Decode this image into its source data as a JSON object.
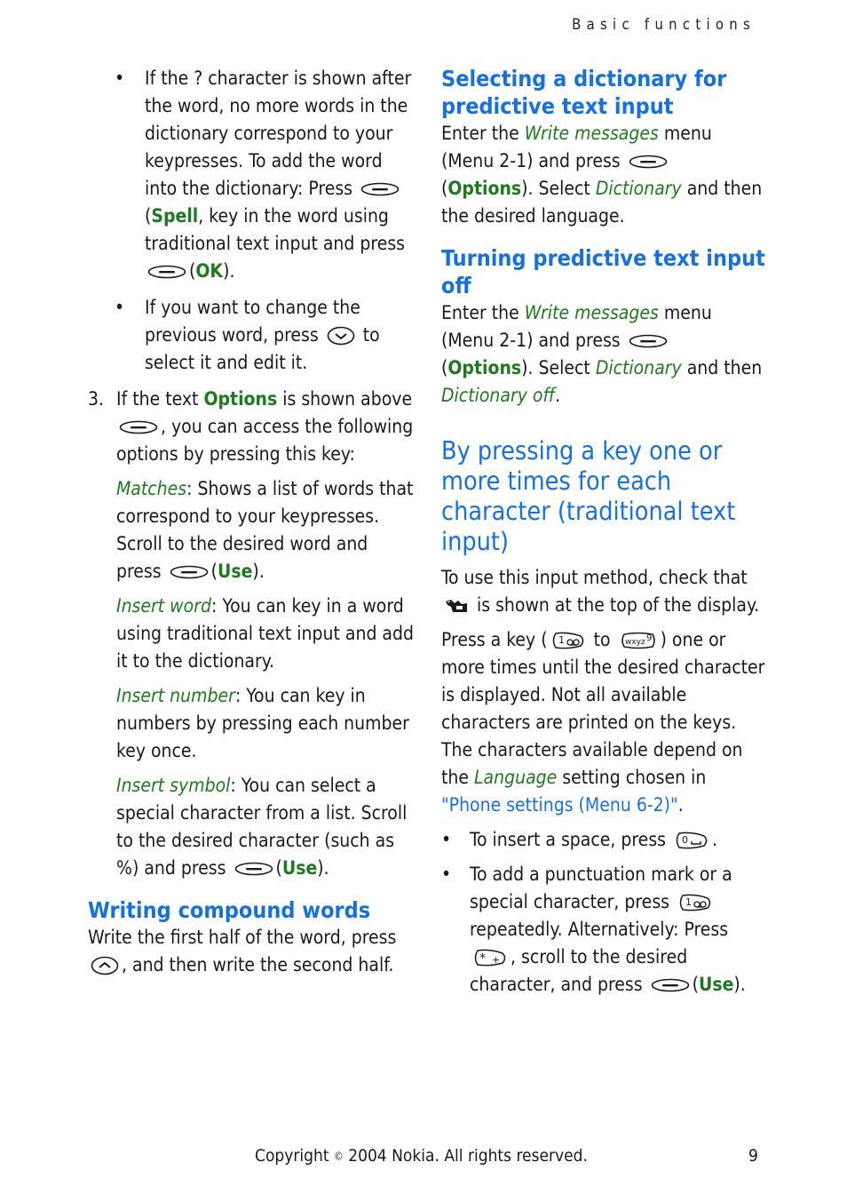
{
  "running_head": "Basic functions",
  "footer": {
    "copyright_pre": "Copyright ",
    "copyright_symbol": "©",
    "copyright_post": " 2004 Nokia. All rights reserved.",
    "page_number": "9"
  },
  "left": {
    "bullet1": {
      "text1": "If the ? character is shown after the word, no more words in the dictionary correspond to your keypresses. To add the word into the dictionary: Press ",
      "spell": "Spell",
      "text2": ", key in the word  using traditional text input and press ",
      "ok": "OK",
      "text3": ")."
    },
    "bullet2": {
      "text1": "If you want to change the previous word, press ",
      "text2": " to select it and edit it."
    },
    "item3": {
      "number": "3.",
      "text1": "If the text ",
      "options": "Options",
      "text2": " is shown above ",
      "text3": ", you can access the following options by pressing this key:"
    },
    "matches": {
      "term": "Matches",
      "text": ": Shows a list of words that correspond to your keypresses. Scroll to the desired word and press ",
      "use": "Use",
      "end": ")."
    },
    "insert_word": {
      "term": "Insert word",
      "text": ":  You can key in a word using traditional text input and add it to the dictionary."
    },
    "insert_number": {
      "term": "Insert number",
      "text": ": You can key in numbers by pressing each number key once."
    },
    "insert_symbol": {
      "term": "Insert symbol",
      "text": ": You can select a special character from a list. Scroll to the desired character (such as %) and press ",
      "use": "Use",
      "end": ")."
    },
    "compound": {
      "heading": "Writing compound words",
      "text1": "Write the first half of the word, press ",
      "text2": ", and then write the second half."
    }
  },
  "right": {
    "select_dict": {
      "heading": "Selecting a dictionary for predictive text input",
      "t1": "Enter the ",
      "write_messages": "Write messages",
      "t2": " menu (Menu 2-1) and press ",
      "options": "Options",
      "t3": "). Select ",
      "dictionary": "Dictionary",
      "t4": " and then the desired language."
    },
    "turn_off": {
      "heading": "Turning predictive text input off",
      "t1": "Enter the ",
      "write_messages": "Write messages",
      "t2": " menu (Menu 2-1) and press ",
      "options": "Options",
      "t3": "). Select ",
      "dictionary": "Dictionary",
      "t4": " and then ",
      "dictionary_off": "Dictionary off",
      "t5": "."
    },
    "traditional": {
      "heading": "By pressing a key one or more times for each character (traditional text input)",
      "p1a": "To use this input method, check that ",
      "p1b": " is shown at the top of the display.",
      "p2a": "Press a key (",
      "p2b": " to ",
      "p2c": ") one or more times until the desired character is displayed. Not all available characters are printed on the keys. The characters available depend on the ",
      "language": "Language",
      "p2d": " setting chosen in ",
      "link": "\"Phone settings (Menu 6-2)\"",
      "p2e": ".",
      "b1a": "To insert a space, press ",
      "b1b": ".",
      "b2a": "To add a punctuation mark or a special character, press ",
      "b2b": " repeatedly. Alternatively: Press ",
      "b2c": ", scroll to the desired character, and press ",
      "use": "Use",
      "b2d": ")."
    }
  },
  "icons": {
    "selection_key": "selection-key-icon",
    "scroll_down": "scroll-down-key-icon",
    "scroll_up": "scroll-up-key-icon",
    "key_1": "1",
    "key_9": "wxyz9",
    "key_0": "0",
    "key_star": "*+",
    "traditional_mode": "traditional-text-mode-indicator-icon"
  },
  "colors": {
    "heading_blue": "#1570e0",
    "term_green": "#1f7a1f",
    "text": "#1a1a1a"
  }
}
